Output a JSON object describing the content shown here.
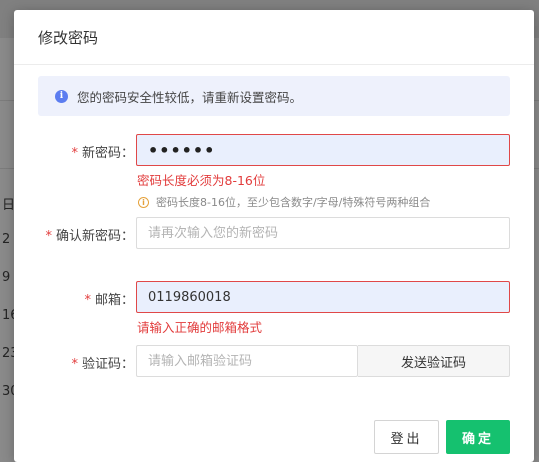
{
  "background": {
    "row_labels": [
      "日",
      "2",
      "9",
      "16",
      "23",
      "30"
    ]
  },
  "modal": {
    "title": "修改密码",
    "alert": {
      "icon": "info-icon",
      "text": "您的密码安全性较低，请重新设置密码。"
    },
    "fields": {
      "new_password": {
        "label": "新密码：",
        "value": "••••••",
        "error": "密码长度必须为8-16位",
        "hint": "密码长度8-16位，至少包含数字/字母/特殊符号两种组合"
      },
      "confirm_password": {
        "label": "确认新密码：",
        "placeholder": "请再次输入您的新密码"
      },
      "email": {
        "label": "邮箱：",
        "value": "0119860018",
        "error": "请输入正确的邮箱格式"
      },
      "code": {
        "label": "验证码：",
        "placeholder": "请输入邮箱验证码",
        "send_label": "发送验证码"
      }
    },
    "buttons": {
      "logout": "登出",
      "confirm": "确定"
    },
    "colors": {
      "primary": "#15c16f",
      "error": "#e23c3c",
      "info": "#5c7df0"
    }
  }
}
